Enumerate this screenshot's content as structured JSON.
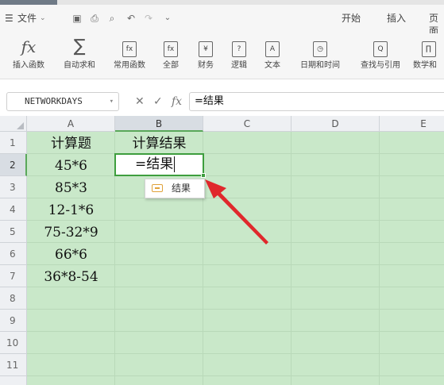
{
  "menu": {
    "menu_icon": "hamburger-icon",
    "file_label": "文件",
    "tabs": [
      "开始",
      "插入",
      "页面"
    ]
  },
  "ribbon": {
    "items": [
      {
        "label": "插入函数",
        "icon": "fx-icon",
        "glyph": "fx"
      },
      {
        "label": "自动求和",
        "icon": "sigma-icon",
        "glyph": "∑"
      },
      {
        "label": "常用函数",
        "icon": "common-function-icon",
        "glyph": "fx"
      },
      {
        "label": "全部",
        "icon": "all-functions-icon",
        "glyph": "fx"
      },
      {
        "label": "财务",
        "icon": "finance-icon",
        "glyph": "¥"
      },
      {
        "label": "逻辑",
        "icon": "logic-icon",
        "glyph": "?"
      },
      {
        "label": "文本",
        "icon": "text-icon",
        "glyph": "A"
      },
      {
        "label": "日期和时间",
        "icon": "clock-icon",
        "glyph": "◷"
      },
      {
        "label": "查找与引用",
        "icon": "lookup-icon",
        "glyph": "Q"
      },
      {
        "label": "数学和",
        "icon": "math-icon",
        "glyph": "∏"
      }
    ]
  },
  "formula_bar": {
    "name_box": "NETWORKDAYS",
    "cancel_glyph": "✕",
    "confirm_glyph": "✓",
    "fx_glyph": "fx",
    "value": "=结果"
  },
  "grid": {
    "columns": [
      "A",
      "B",
      "C",
      "D",
      "E"
    ],
    "selected_column": "B",
    "rows": [
      "1",
      "2",
      "3",
      "4",
      "5",
      "6",
      "7",
      "8",
      "9",
      "10",
      "11"
    ],
    "selected_row": "2",
    "cells": {
      "A1": "计算题",
      "B1": "计算结果",
      "A2": "45*6",
      "A3": "85*3",
      "A4": "12-1*6",
      "A5": "75-32*9",
      "A6": "66*6",
      "A7": "36*8-54"
    },
    "editing_cell_value": "=结果",
    "autocomplete_suggestion": "结果"
  },
  "colors": {
    "grid_background": "#c9e8c9",
    "selection_border": "#3e9e3e",
    "arrow": "#e0282c"
  }
}
